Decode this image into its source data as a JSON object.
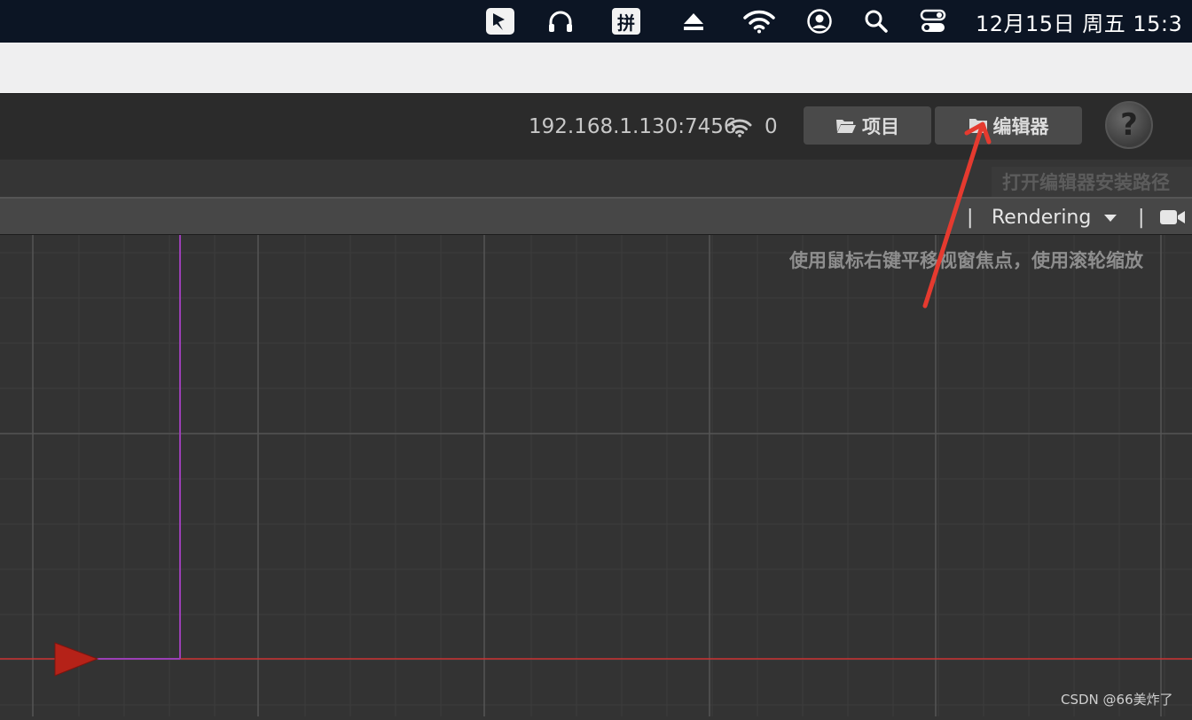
{
  "menubar": {
    "items": [
      {
        "name": "feishu-icon"
      },
      {
        "name": "headphones-icon"
      },
      {
        "name": "input-method",
        "label": "拼"
      },
      {
        "name": "eject-icon"
      },
      {
        "name": "wifi-icon"
      },
      {
        "name": "user-account-icon"
      },
      {
        "name": "spotlight-search-icon"
      },
      {
        "name": "control-center-icon"
      }
    ],
    "clock": "12月15日 周五  15:3"
  },
  "toolbar": {
    "ip_address": "192.168.1.130:7456",
    "connection_count": "0",
    "project_button": "项目",
    "editor_button": "编辑器",
    "help_label": "?"
  },
  "tooltip": {
    "text": "打开编辑器安装路径"
  },
  "scene_header": {
    "separator_1": "|",
    "separator_2": "|",
    "rendering_dropdown": "Rendering"
  },
  "viewport": {
    "hint": "使用鼠标右键平移视窗焦点，使用滚轮缩放"
  },
  "watermark": "CSDN @66美炸了",
  "colors": {
    "menubar_bg": "#0c1524",
    "toolbar_bg": "#2b2b2b",
    "button_bg": "#4a4a4a",
    "viewport_bg": "#333333",
    "grid_line": "#3c3c3c",
    "grid_major": "#555555",
    "x_axis": "#cc3333",
    "y_axis": "#9b3fb5",
    "annotation_arrow": "#e53a2f"
  }
}
